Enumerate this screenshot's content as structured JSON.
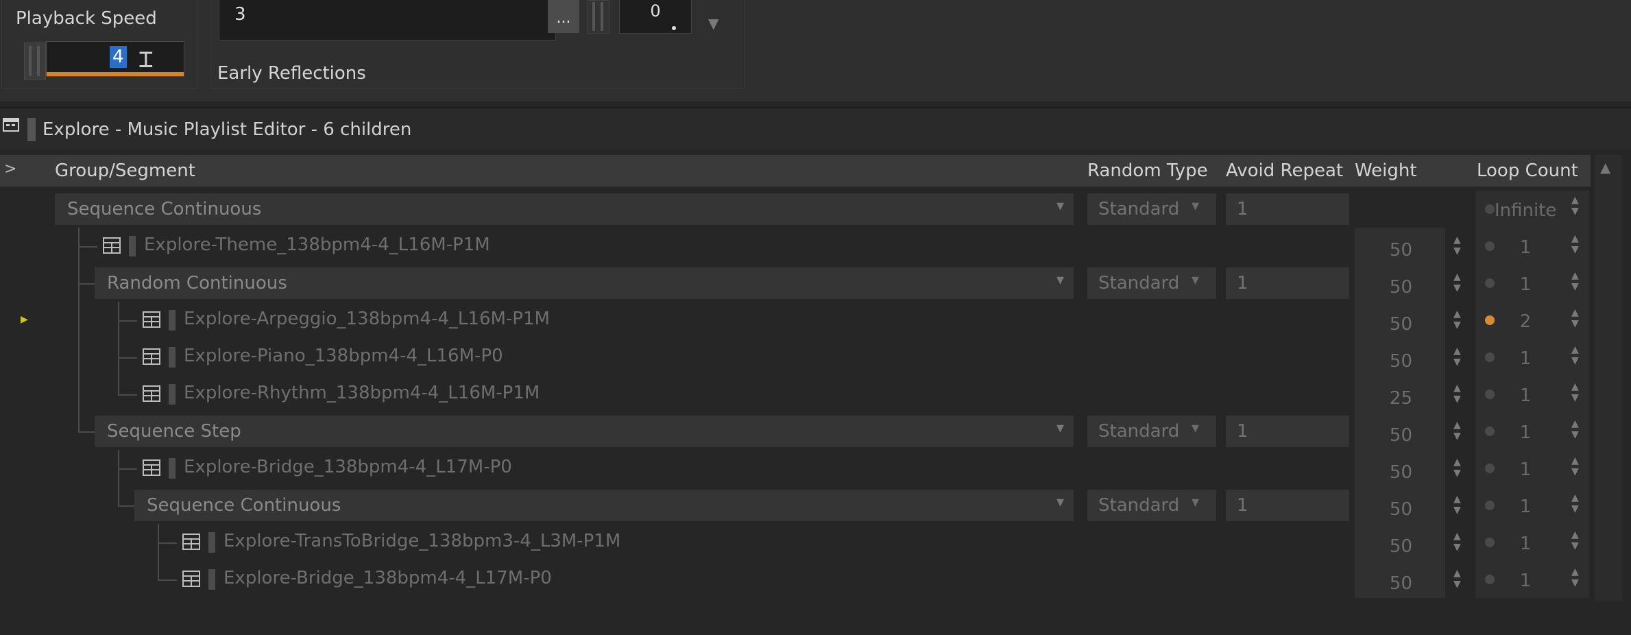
{
  "playback": {
    "label": "Playback Speed",
    "value": "4"
  },
  "reverb": {
    "field_value": "3",
    "browse_label": "...",
    "number_value": "0",
    "label": "Early Reflections"
  },
  "title": "Explore - Music Playlist Editor - 6 children",
  "columns": {
    "expand": ">",
    "group_segment": "Group/Segment",
    "random_type": "Random Type",
    "avoid_repeat": "Avoid Repeat",
    "weight": "Weight",
    "loop_count": "Loop Count"
  },
  "rows": [
    {
      "type": "group",
      "label": "Sequence Continuous",
      "random_type": "Standard",
      "avoid_repeat": "1",
      "weight": "",
      "loop": "Infinite",
      "loop_active": false
    },
    {
      "type": "segment",
      "label": "Explore-Theme_138bpm4-4_L16M-P1M",
      "weight": "50",
      "loop": "1",
      "loop_active": false
    },
    {
      "type": "group",
      "label": "Random Continuous",
      "random_type": "Standard",
      "avoid_repeat": "1",
      "weight": "50",
      "loop": "1",
      "loop_active": false
    },
    {
      "type": "segment",
      "label": "Explore-Arpeggio_138bpm4-4_L16M-P1M",
      "weight": "50",
      "loop": "2",
      "loop_active": true
    },
    {
      "type": "segment",
      "label": "Explore-Piano_138bpm4-4_L16M-P0",
      "weight": "50",
      "loop": "1",
      "loop_active": false
    },
    {
      "type": "segment",
      "label": "Explore-Rhythm_138bpm4-4_L16M-P1M",
      "weight": "25",
      "loop": "1",
      "loop_active": false
    },
    {
      "type": "group",
      "label": "Sequence Step",
      "random_type": "Standard",
      "avoid_repeat": "1",
      "weight": "50",
      "loop": "1",
      "loop_active": false
    },
    {
      "type": "segment",
      "label": "Explore-Bridge_138bpm4-4_L17M-P0",
      "weight": "50",
      "loop": "1",
      "loop_active": false
    },
    {
      "type": "group",
      "label": "Sequence Continuous",
      "random_type": "Standard",
      "avoid_repeat": "1",
      "weight": "50",
      "loop": "1",
      "loop_active": false
    },
    {
      "type": "segment",
      "label": "Explore-TransToBridge_138bpm3-4_L3M-P1M",
      "weight": "50",
      "loop": "1",
      "loop_active": false
    },
    {
      "type": "segment",
      "label": "Explore-Bridge_138bpm4-4_L17M-P0",
      "weight": "50",
      "loop": "1",
      "loop_active": false
    }
  ],
  "icons": {
    "layout": "layout-icon",
    "segment": "music-segment-icon",
    "dropdown": "chevron-down-icon",
    "spinner": "spinner-arrows-icon",
    "play": "play-indicator-icon"
  },
  "colors": {
    "accent": "#d9822b",
    "selection": "#2b6fc4",
    "active_loop": "#d88b33",
    "play": "#d4c021"
  }
}
